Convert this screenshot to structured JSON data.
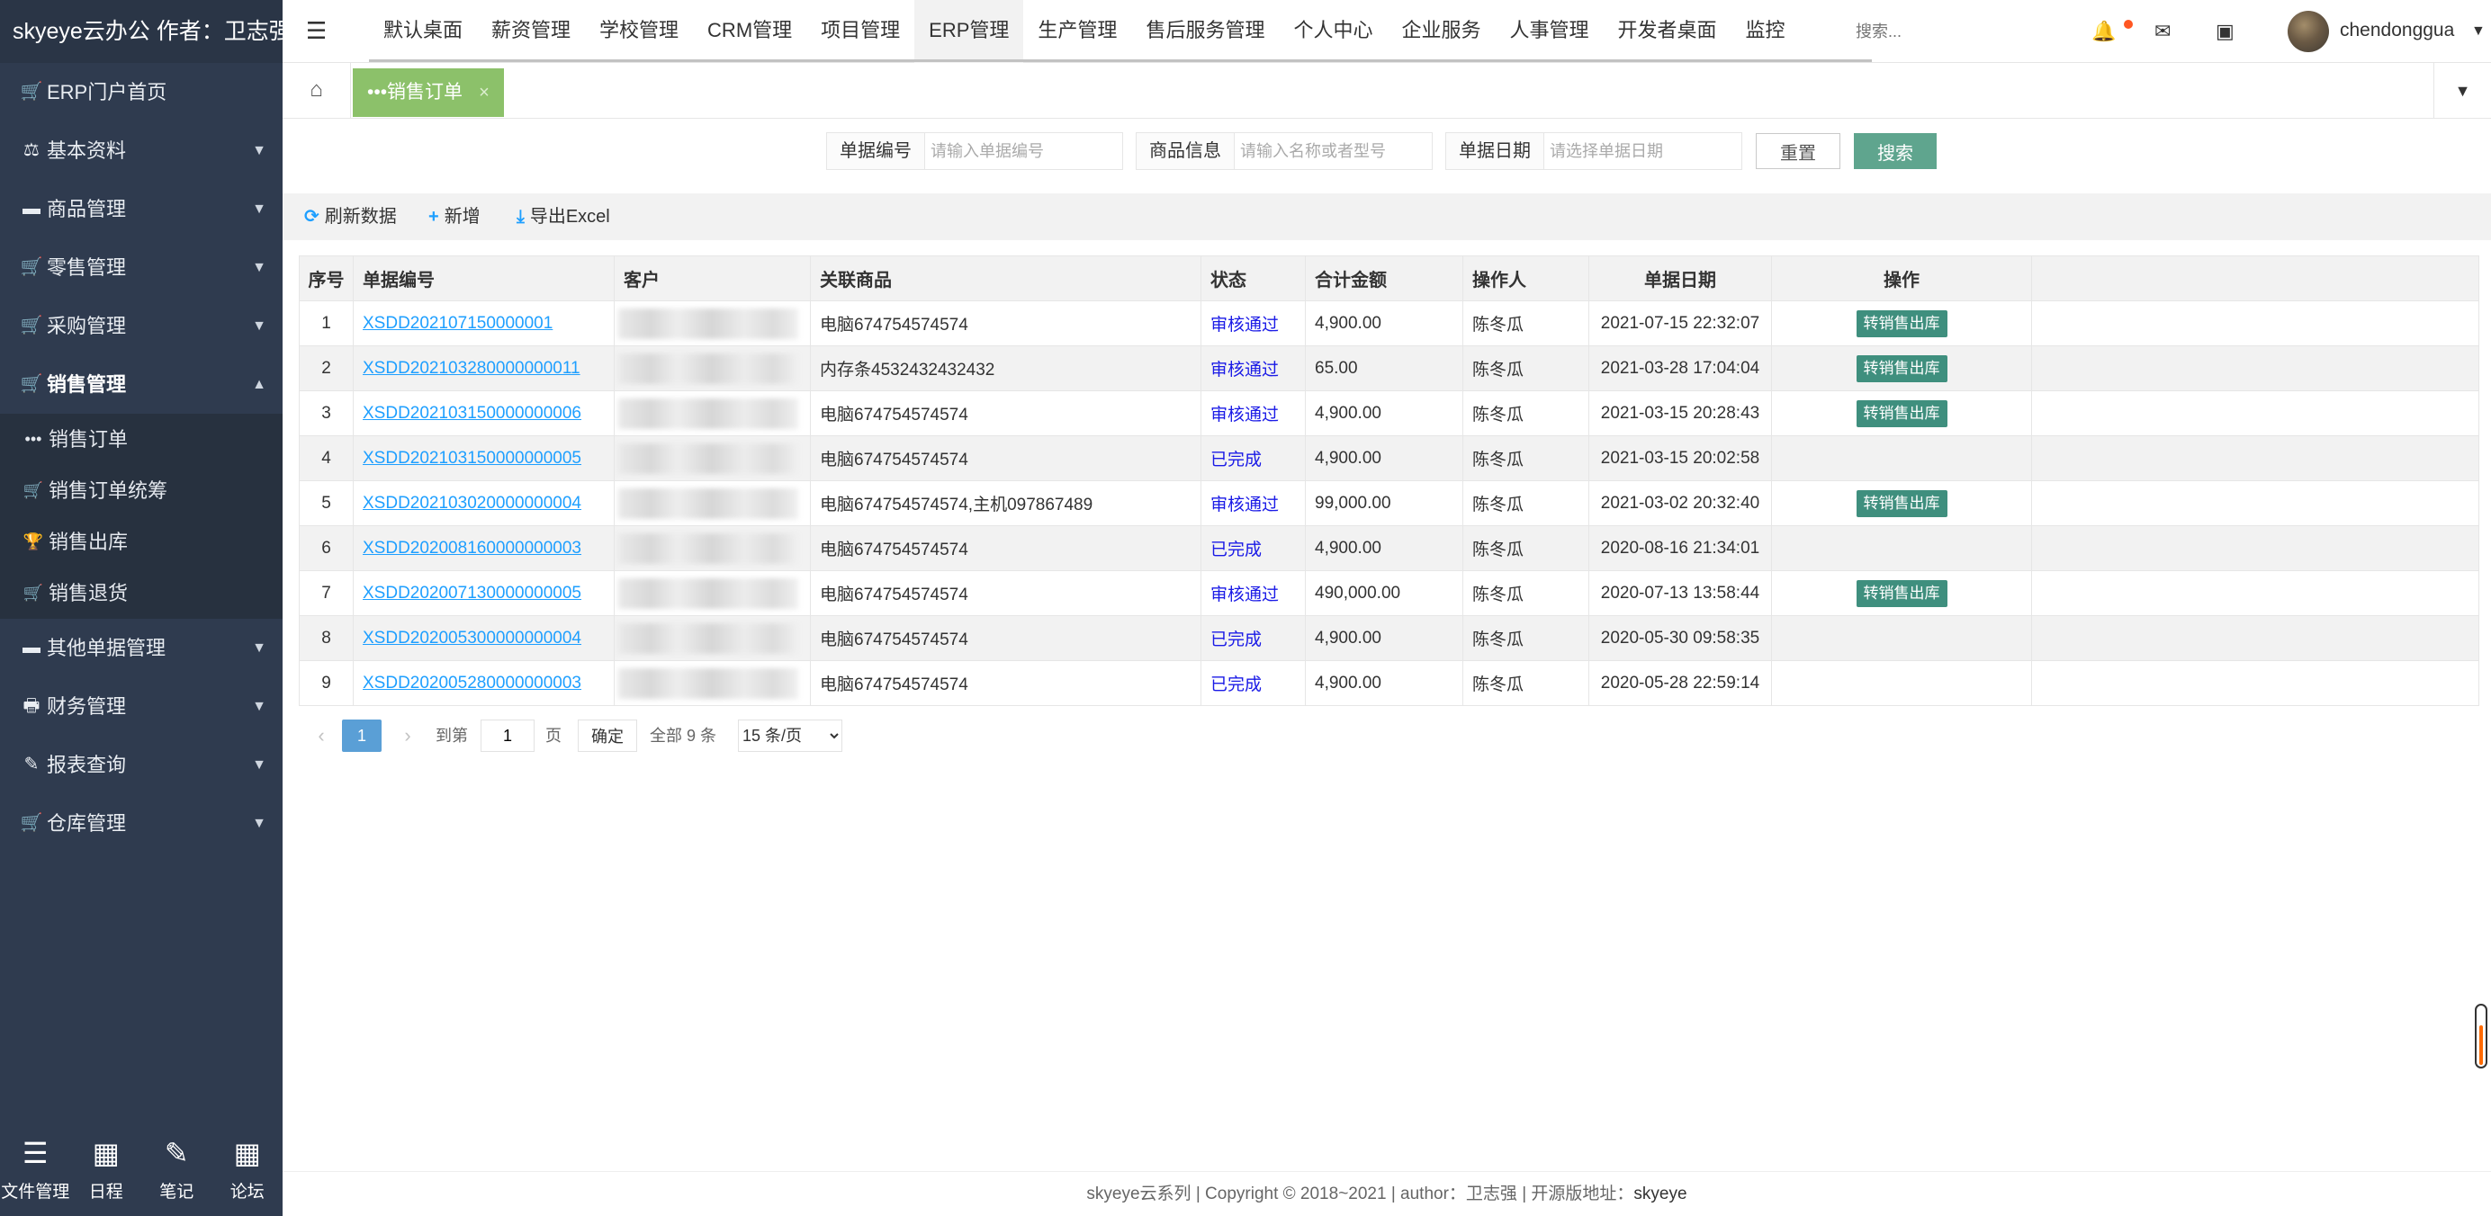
{
  "brand": {
    "title": "skyeye云办公 作者：卫志强"
  },
  "sidebar": {
    "items": [
      {
        "label": "ERP门户首页",
        "icon": "cart-icon",
        "has_caret": false
      },
      {
        "label": "基本资料",
        "icon": "scale-icon",
        "has_caret": true
      },
      {
        "label": "商品管理",
        "icon": "archive-icon",
        "has_caret": true
      },
      {
        "label": "零售管理",
        "icon": "cart-icon",
        "has_caret": true
      },
      {
        "label": "采购管理",
        "icon": "cart-icon",
        "has_caret": true
      },
      {
        "label": "销售管理",
        "icon": "cart-icon",
        "has_caret": true,
        "expanded": true
      }
    ],
    "sub_items": [
      {
        "label": "销售订单",
        "icon": "ellipsis-icon"
      },
      {
        "label": "销售订单统筹",
        "icon": "cart-icon"
      },
      {
        "label": "销售出库",
        "icon": "trophy-icon"
      },
      {
        "label": "销售退货",
        "icon": "cart-icon"
      }
    ],
    "items_after": [
      {
        "label": "其他单据管理",
        "icon": "archive-icon",
        "has_caret": true
      },
      {
        "label": "财务管理",
        "icon": "print-icon",
        "has_caret": true
      },
      {
        "label": "报表查询",
        "icon": "edit-icon",
        "has_caret": true
      },
      {
        "label": "仓库管理",
        "icon": "cart-icon",
        "has_caret": true
      }
    ],
    "dock": [
      {
        "label": "文件管理",
        "icon": "list-icon"
      },
      {
        "label": "日程",
        "icon": "calendar-icon"
      },
      {
        "label": "笔记",
        "icon": "pen-icon"
      },
      {
        "label": "论坛",
        "icon": "calendar-icon"
      }
    ]
  },
  "topnav": {
    "tabs": [
      "默认桌面",
      "薪资管理",
      "学校管理",
      "CRM管理",
      "项目管理",
      "ERP管理",
      "生产管理",
      "售后服务管理",
      "个人中心",
      "企业服务",
      "人事管理",
      "开发者桌面",
      "监控"
    ],
    "active_tab": "ERP管理",
    "search_placeholder": "搜索...",
    "username": "chendonggua"
  },
  "tabstrip": {
    "page_tab": "•••销售订单",
    "close": "×"
  },
  "filters": {
    "order_no": {
      "label": "单据编号",
      "placeholder": "请输入单据编号"
    },
    "product": {
      "label": "商品信息",
      "placeholder": "请输入名称或者型号"
    },
    "date": {
      "label": "单据日期",
      "placeholder": "请选择单据日期"
    },
    "reset": "重置",
    "search": "搜索"
  },
  "toolbar": {
    "refresh": "刷新数据",
    "add": "新增",
    "export": "导出Excel"
  },
  "table": {
    "headers": {
      "idx": "序号",
      "order_no": "单据编号",
      "customer": "客户",
      "product": "关联商品",
      "status": "状态",
      "amount": "合计金额",
      "operator": "操作人",
      "date": "单据日期",
      "action": "操作"
    },
    "rows": [
      {
        "idx": "1",
        "order_no": "XSDD202107150000001",
        "product": "电脑674754574574",
        "status": "审核通过",
        "amount": "4,900.00",
        "operator": "陈冬瓜",
        "date": "2021-07-15 22:32:07",
        "action": "转销售出库"
      },
      {
        "idx": "2",
        "order_no": "XSDD202103280000000011",
        "product": "内存条4532432432432",
        "status": "审核通过",
        "amount": "65.00",
        "operator": "陈冬瓜",
        "date": "2021-03-28 17:04:04",
        "action": "转销售出库"
      },
      {
        "idx": "3",
        "order_no": "XSDD202103150000000006",
        "product": "电脑674754574574",
        "status": "审核通过",
        "amount": "4,900.00",
        "operator": "陈冬瓜",
        "date": "2021-03-15 20:28:43",
        "action": "转销售出库"
      },
      {
        "idx": "4",
        "order_no": "XSDD202103150000000005",
        "product": "电脑674754574574",
        "status": "已完成",
        "amount": "4,900.00",
        "operator": "陈冬瓜",
        "date": "2021-03-15 20:02:58",
        "action": ""
      },
      {
        "idx": "5",
        "order_no": "XSDD202103020000000004",
        "product": "电脑674754574574,主机097867489",
        "status": "审核通过",
        "amount": "99,000.00",
        "operator": "陈冬瓜",
        "date": "2021-03-02 20:32:40",
        "action": "转销售出库"
      },
      {
        "idx": "6",
        "order_no": "XSDD202008160000000003",
        "product": "电脑674754574574",
        "status": "已完成",
        "amount": "4,900.00",
        "operator": "陈冬瓜",
        "date": "2020-08-16 21:34:01",
        "action": ""
      },
      {
        "idx": "7",
        "order_no": "XSDD202007130000000005",
        "product": "电脑674754574574",
        "status": "审核通过",
        "amount": "490,000.00",
        "operator": "陈冬瓜",
        "date": "2020-07-13 13:58:44",
        "action": "转销售出库"
      },
      {
        "idx": "8",
        "order_no": "XSDD202005300000000004",
        "product": "电脑674754574574",
        "status": "已完成",
        "amount": "4,900.00",
        "operator": "陈冬瓜",
        "date": "2020-05-30 09:58:35",
        "action": ""
      },
      {
        "idx": "9",
        "order_no": "XSDD202005280000000003",
        "product": "电脑674754574574",
        "status": "已完成",
        "amount": "4,900.00",
        "operator": "陈冬瓜",
        "date": "2020-05-28 22:59:14",
        "action": ""
      }
    ]
  },
  "pager": {
    "prev": "‹",
    "current": "1",
    "next": "›",
    "goto_label": "到第",
    "goto_value": "1",
    "page_unit": "页",
    "confirm": "确定",
    "total": "全部 9 条",
    "page_size": "15 条/页"
  },
  "footer": {
    "text": "skyeye云系列 | Copyright © 2018~2021 | author：卫志强 | 开源版地址：",
    "link": "skyeye"
  },
  "colors": {
    "sidebar_bg": "#2f3b4f",
    "page_tab_bg": "#8cc16a",
    "search_button": "#5fa58e",
    "action_button": "#3f8f7e",
    "link": "#1e9fff",
    "status": "#1a1ae6"
  }
}
